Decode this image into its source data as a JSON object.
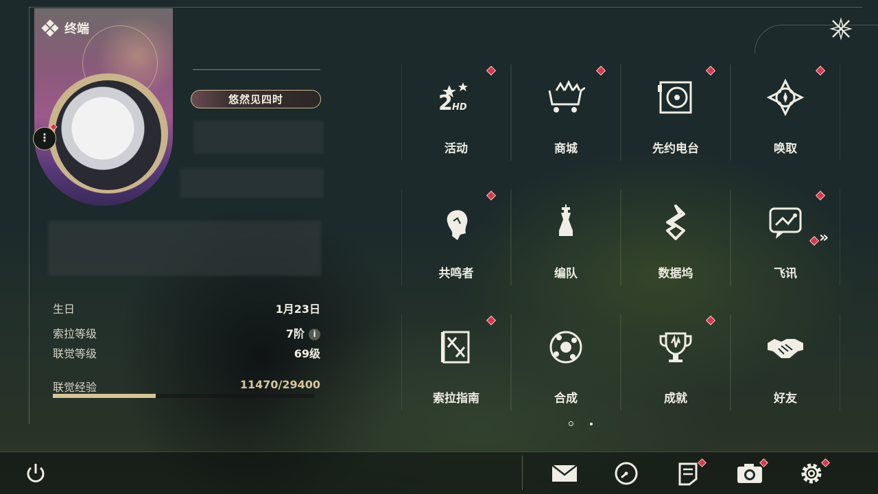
{
  "header": {
    "title": "终端"
  },
  "profile": {
    "title_badge": "悠然见四时",
    "info": [
      {
        "label": "生日",
        "value": "1月23日"
      },
      {
        "label": "索拉等级",
        "value": "7阶"
      },
      {
        "label": "联觉等级",
        "value": "69级"
      }
    ],
    "xp": {
      "label": "联觉经验",
      "value": "11470/29400",
      "current": 11470,
      "max": 29400
    }
  },
  "menu": {
    "tiles": [
      {
        "label": "活动",
        "icon": "event-icon",
        "badge": true
      },
      {
        "label": "商城",
        "icon": "shop-cart-icon",
        "badge": true
      },
      {
        "label": "先约电台",
        "icon": "radio-icon",
        "badge": true
      },
      {
        "label": "唤取",
        "icon": "summon-compass-icon",
        "badge": true
      },
      {
        "label": "共鸣者",
        "icon": "resonator-icon",
        "badge": true
      },
      {
        "label": "编队",
        "icon": "chess-team-icon",
        "badge": false
      },
      {
        "label": "数据坞",
        "icon": "data-bank-icon",
        "badge": false
      },
      {
        "label": "飞讯",
        "icon": "message-icon",
        "badge": true
      },
      {
        "label": "索拉指南",
        "icon": "guide-book-icon",
        "badge": true
      },
      {
        "label": "合成",
        "icon": "synthesis-icon",
        "badge": false
      },
      {
        "label": "成就",
        "icon": "trophy-icon",
        "badge": true
      },
      {
        "label": "好友",
        "icon": "handshake-icon",
        "badge": false
      }
    ],
    "next_page_symbol": "»",
    "pages": 2,
    "current_page": 1
  },
  "colors": {
    "accent": "#c9b48c",
    "badge": "#d23a4a",
    "text": "#f0ede4"
  },
  "bottom_bar": {
    "icons": [
      "power-icon",
      "mail-icon",
      "clock-icon",
      "notice-icon",
      "camera-icon",
      "settings-gear-icon"
    ]
  }
}
